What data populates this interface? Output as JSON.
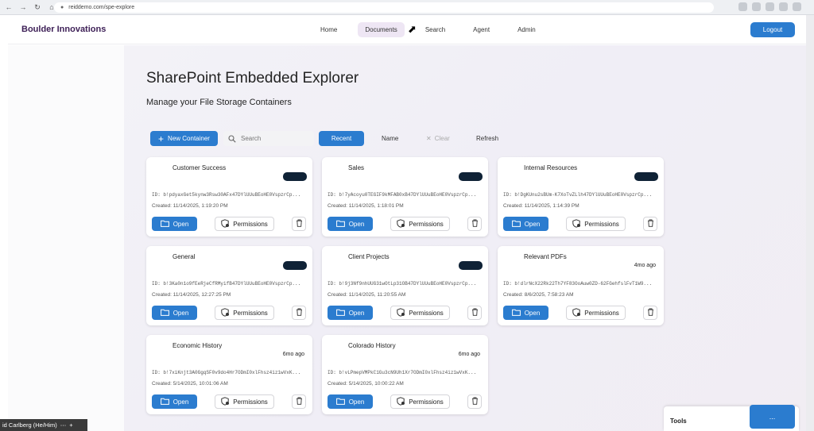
{
  "browser": {
    "url": "reiddemo.com/spe-explore"
  },
  "header": {
    "brand": "Boulder Innovations",
    "nav": [
      "Home",
      "Documents",
      "Search",
      "Agent",
      "Admin"
    ],
    "active_nav": "Documents",
    "logout_label": "Logout"
  },
  "page": {
    "title": "SharePoint Embedded Explorer",
    "subtitle": "Manage your File Storage Containers"
  },
  "toolbar": {
    "new_container_label": "New Container",
    "search_placeholder": "Search",
    "recent_label": "Recent",
    "name_label": "Name",
    "clear_label": "Clear",
    "refresh_label": "Refresh"
  },
  "card_actions": {
    "open_label": "Open",
    "permissions_label": "Permissions"
  },
  "containers": [
    {
      "name": "Customer Success",
      "badge": true,
      "ago": "",
      "id": "ID: b!pdyaxGet5kynw3Rsw30AFx47DYlUUuBEoHE0VspzrCp...",
      "created": "Created: 11/14/2025, 1:19:20 PM"
    },
    {
      "name": "Sales",
      "badge": true,
      "ago": "",
      "id": "ID: b!7yAcoyu0TEGIF9kMFAB0xB47DYlUUuBEoHE0VspzrCp...",
      "created": "Created: 11/14/2025, 1:18:01 PM"
    },
    {
      "name": "Internal Resources",
      "badge": true,
      "ago": "",
      "id": "ID: b!DgKUnu2sBUm-K7XoTvZLlh47DYlUUuBEoHE0VspzrCp...",
      "created": "Created: 11/14/2025, 1:14:39 PM"
    },
    {
      "name": "General",
      "badge": true,
      "ago": "",
      "id": "ID: b!3Ka0n1o9fEeRjeCfRMyifB47DYlUUuBEoHE0VspzrCp...",
      "created": "Created: 11/14/2025, 12:27:25 PM"
    },
    {
      "name": "Client Projects",
      "badge": true,
      "ago": "",
      "id": "ID: b!9j3Nf9nhUUG31wOtLp31OB47DYlUUuBEoHE0VspzrCp...",
      "created": "Created: 11/14/2025, 11:20:55 AM"
    },
    {
      "name": "Relevant PDFs",
      "badge": false,
      "ago": "4mo ago",
      "id": "ID: b!dlrNcX22Rk22Th7YF83OoAuw0ZD-62FGehfslFvT1W9...",
      "created": "Created: 8/6/2025, 7:58:23 AM"
    },
    {
      "name": "Economic History",
      "badge": false,
      "ago": "6mo ago",
      "id": "ID: b!7xiKnjt3A0GgqSF0v9do4Hr7ODmI0xlFhsz4iz1wVxK...",
      "created": "Created: 5/14/2025, 10:01:06 AM"
    },
    {
      "name": "Colorado History",
      "badge": false,
      "ago": "6mo ago",
      "id": "ID: b!vLPmepVMPkC1Gu3cN9Uh1Xr7ODmI0xlFhsz4iz1wVxK...",
      "created": "Created: 5/14/2025, 10:00:22 AM"
    }
  ],
  "overlay": {
    "user_tag": "id Carlberg (He/Him)",
    "tools_label": "Tools",
    "tools_more": "..."
  },
  "colors": {
    "accent": "#2b7ccf",
    "brand": "#3d1f56",
    "badge": "#0f2236"
  }
}
